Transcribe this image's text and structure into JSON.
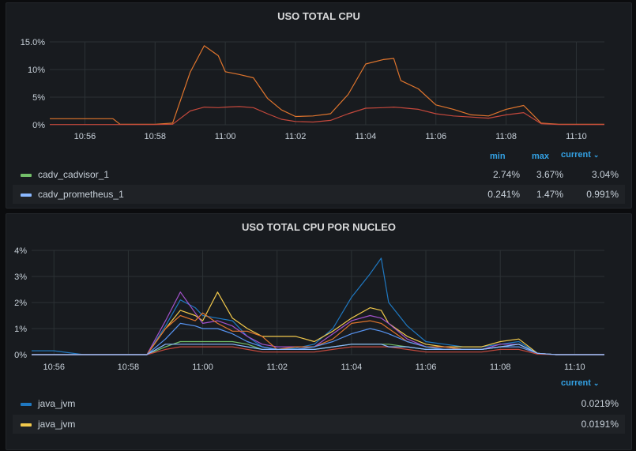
{
  "panels": {
    "top": {
      "title": "USO TOTAL CPU",
      "legend": {
        "headers": {
          "min": "min",
          "max": "max",
          "current": "current"
        },
        "rows": [
          {
            "name": "cadv_cadvisor_1",
            "color": "#73bf69",
            "min": "2.74%",
            "max": "3.67%",
            "current": "3.04%"
          },
          {
            "name": "cadv_prometheus_1",
            "color": "#8ab8ff",
            "min": "0.241%",
            "max": "1.47%",
            "current": "0.991%"
          }
        ]
      }
    },
    "bottom": {
      "title": "USO TOTAL CPU POR NUCLEO",
      "legend": {
        "headers": {
          "current": "current"
        },
        "rows": [
          {
            "name": "java_jvm",
            "color": "#1f78c1",
            "current": "0.0219%"
          },
          {
            "name": "java_jvm",
            "color": "#f2c94c",
            "current": "0.0191%"
          }
        ]
      }
    }
  },
  "chart_data": [
    {
      "type": "line",
      "title": "USO TOTAL CPU",
      "xlabel": "",
      "ylabel": "",
      "x_ticks": [
        "10:56",
        "10:58",
        "11:00",
        "11:02",
        "11:04",
        "11:06",
        "11:08",
        "11:10"
      ],
      "y_ticks": [
        "0%",
        "5%",
        "10%",
        "15.0%"
      ],
      "ylim": [
        0,
        15
      ],
      "x": [
        "10:55",
        "10:56",
        "10:56.8",
        "10:57",
        "10:58",
        "10:58.5",
        "10:59",
        "10:59.4",
        "10:59.8",
        "11:00",
        "11:00.4",
        "11:00.8",
        "11:01.2",
        "11:01.6",
        "11:02",
        "11:02.5",
        "11:03",
        "11:03.5",
        "11:04",
        "11:04.5",
        "11:04.8",
        "11:05",
        "11:05.5",
        "11:06",
        "11:06.5",
        "11:07",
        "11:07.5",
        "11:08",
        "11:08.5",
        "11:09",
        "11:09.5",
        "11:10",
        "11:10.8"
      ],
      "series": [
        {
          "color": "#e0752d",
          "values": [
            1.1,
            1.1,
            1.1,
            0.1,
            0.1,
            0.3,
            9.5,
            14.3,
            12.5,
            9.6,
            9.1,
            8.5,
            4.8,
            2.7,
            1.5,
            1.6,
            2.0,
            5.5,
            11.0,
            11.8,
            12.0,
            8.0,
            6.5,
            3.6,
            2.8,
            1.8,
            1.6,
            2.8,
            3.5,
            0.3,
            0.1,
            0.1,
            0.1
          ]
        },
        {
          "color": "#c4483c",
          "values": [
            0.05,
            0.05,
            0.05,
            0.05,
            0.05,
            0.1,
            2.5,
            3.2,
            3.1,
            3.2,
            3.3,
            3.1,
            2.0,
            1.0,
            0.6,
            0.5,
            0.8,
            2.0,
            3.0,
            3.1,
            3.2,
            3.1,
            2.8,
            2.0,
            1.6,
            1.4,
            1.2,
            1.8,
            2.2,
            0.2,
            0.05,
            0.05,
            0.05
          ]
        }
      ]
    },
    {
      "type": "line",
      "title": "USO TOTAL CPU POR NUCLEO",
      "xlabel": "",
      "ylabel": "",
      "x_ticks": [
        "10:56",
        "10:58",
        "11:00",
        "11:02",
        "11:04",
        "11:06",
        "11:08",
        "11:10"
      ],
      "y_ticks": [
        "0%",
        "1%",
        "2%",
        "3%",
        "4%"
      ],
      "ylim": [
        0,
        4
      ],
      "x": [
        "10:55.4",
        "10:56",
        "10:56.8",
        "10:57",
        "10:58",
        "10:58.5",
        "10:59",
        "10:59.4",
        "10:59.8",
        "11:00",
        "11:00.4",
        "11:00.8",
        "11:01.2",
        "11:01.6",
        "11:02",
        "11:02.5",
        "11:03",
        "11:03.5",
        "11:04",
        "11:04.5",
        "11:04.8",
        "11:05",
        "11:05.5",
        "11:06",
        "11:06.5",
        "11:07",
        "11:07.5",
        "11:08",
        "11:08.5",
        "11:09",
        "11:09.5",
        "11:10",
        "11:10.8"
      ],
      "series": [
        {
          "color": "#1f78c1",
          "values": [
            0.15,
            0.15,
            0.0,
            0.0,
            0.0,
            0.0,
            1.1,
            2.1,
            1.8,
            1.5,
            1.4,
            1.3,
            0.7,
            0.3,
            0.2,
            0.25,
            0.4,
            1.0,
            2.2,
            3.1,
            3.7,
            2.0,
            1.1,
            0.5,
            0.4,
            0.3,
            0.3,
            0.4,
            0.5,
            0.05,
            0.0,
            0.0,
            0.0
          ]
        },
        {
          "color": "#f2c94c",
          "values": [
            0.0,
            0.0,
            0.0,
            0.0,
            0.0,
            0.0,
            1.0,
            1.7,
            1.5,
            1.3,
            2.4,
            1.4,
            1.0,
            0.7,
            0.7,
            0.7,
            0.5,
            0.9,
            1.4,
            1.8,
            1.7,
            1.2,
            0.7,
            0.4,
            0.3,
            0.3,
            0.3,
            0.5,
            0.6,
            0.05,
            0.0,
            0.0,
            0.0
          ]
        },
        {
          "color": "#a352cc",
          "values": [
            0.0,
            0.0,
            0.0,
            0.0,
            0.0,
            0.0,
            1.3,
            2.4,
            1.6,
            1.2,
            1.3,
            1.1,
            0.7,
            0.4,
            0.3,
            0.3,
            0.3,
            0.8,
            1.3,
            1.5,
            1.4,
            1.2,
            0.6,
            0.3,
            0.3,
            0.2,
            0.2,
            0.4,
            0.4,
            0.05,
            0.0,
            0.0,
            0.0
          ]
        },
        {
          "color": "#e0752d",
          "values": [
            0.0,
            0.0,
            0.0,
            0.0,
            0.0,
            0.0,
            1.0,
            1.5,
            1.3,
            1.6,
            1.2,
            0.9,
            0.9,
            0.7,
            0.2,
            0.3,
            0.3,
            0.6,
            1.2,
            1.3,
            1.2,
            1.0,
            0.5,
            0.3,
            0.3,
            0.2,
            0.2,
            0.3,
            0.3,
            0.05,
            0.0,
            0.0,
            0.0
          ]
        },
        {
          "color": "#73bf69",
          "values": [
            0.0,
            0.0,
            0.0,
            0.0,
            0.0,
            0.0,
            0.3,
            0.5,
            0.5,
            0.5,
            0.5,
            0.5,
            0.4,
            0.2,
            0.2,
            0.2,
            0.2,
            0.3,
            0.4,
            0.4,
            0.4,
            0.4,
            0.3,
            0.2,
            0.2,
            0.2,
            0.2,
            0.3,
            0.4,
            0.05,
            0.0,
            0.0,
            0.0
          ]
        },
        {
          "color": "#5794f2",
          "values": [
            0.0,
            0.0,
            0.0,
            0.0,
            0.0,
            0.0,
            0.6,
            1.2,
            1.1,
            1.0,
            1.0,
            0.8,
            0.5,
            0.3,
            0.2,
            0.2,
            0.3,
            0.5,
            0.8,
            1.0,
            0.9,
            0.8,
            0.5,
            0.3,
            0.2,
            0.2,
            0.2,
            0.3,
            0.3,
            0.05,
            0.0,
            0.0,
            0.0
          ]
        },
        {
          "color": "#c4483c",
          "values": [
            0.0,
            0.0,
            0.0,
            0.0,
            0.0,
            0.0,
            0.2,
            0.3,
            0.3,
            0.3,
            0.3,
            0.3,
            0.2,
            0.1,
            0.1,
            0.1,
            0.1,
            0.2,
            0.3,
            0.3,
            0.3,
            0.3,
            0.2,
            0.1,
            0.1,
            0.1,
            0.1,
            0.2,
            0.2,
            0.02,
            0.0,
            0.0,
            0.0
          ]
        },
        {
          "color": "#8ab8ff",
          "values": [
            0.0,
            0.0,
            0.0,
            0.0,
            0.0,
            0.0,
            0.4,
            0.4,
            0.4,
            0.4,
            0.4,
            0.4,
            0.3,
            0.2,
            0.2,
            0.2,
            0.2,
            0.3,
            0.4,
            0.4,
            0.4,
            0.3,
            0.3,
            0.2,
            0.2,
            0.2,
            0.2,
            0.3,
            0.4,
            0.05,
            0.0,
            0.0,
            0.0
          ]
        }
      ]
    }
  ]
}
